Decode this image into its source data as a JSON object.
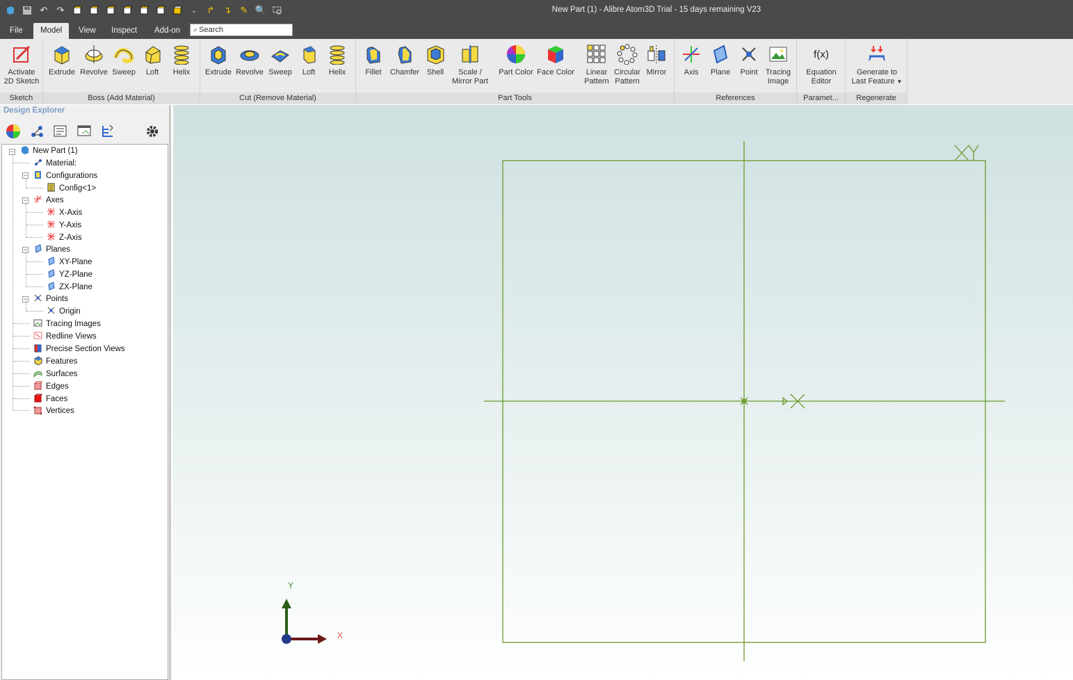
{
  "window": {
    "title": "New Part (1) - Alibre Atom3D  Trial - 15 days remaining V23"
  },
  "quick_access": [
    "app-icon",
    "save-icon",
    "undo-icon",
    "redo-icon",
    "view-front-icon",
    "view-back-icon",
    "view-top-icon",
    "view-bottom-icon",
    "view-left-icon",
    "view-right-icon",
    "view-iso-icon",
    "dropdown-icon",
    "move-icon",
    "rotate-icon",
    "measure-icon",
    "zoom-icon",
    "zoom-window-icon"
  ],
  "menu": {
    "tabs": [
      "File",
      "Model",
      "View",
      "Inspect",
      "Add-on"
    ],
    "active": "Model",
    "search_placeholder": "Search"
  },
  "ribbon": {
    "groups": [
      {
        "label": "Sketch",
        "buttons": [
          {
            "label1": "Activate",
            "label2": "2D Sketch"
          }
        ]
      },
      {
        "label": "Boss (Add Material)",
        "buttons": [
          {
            "label1": "Extrude"
          },
          {
            "label1": "Revolve"
          },
          {
            "label1": "Sweep"
          },
          {
            "label1": "Loft"
          },
          {
            "label1": "Helix"
          }
        ]
      },
      {
        "label": "Cut (Remove Material)",
        "buttons": [
          {
            "label1": "Extrude"
          },
          {
            "label1": "Revolve"
          },
          {
            "label1": "Sweep"
          },
          {
            "label1": "Loft"
          },
          {
            "label1": "Helix"
          }
        ]
      },
      {
        "label": "Part Tools",
        "buttons": [
          {
            "label1": "Fillet"
          },
          {
            "label1": "Chamfer"
          },
          {
            "label1": "Shell"
          },
          {
            "label1": "Scale /",
            "label2": "Mirror Part"
          },
          {
            "label1": "Part Color"
          },
          {
            "label1": "Face Color"
          },
          {
            "label1": "Linear",
            "label2": "Pattern"
          },
          {
            "label1": "Circular",
            "label2": "Pattern"
          },
          {
            "label1": "Mirror"
          }
        ]
      },
      {
        "label": "References",
        "buttons": [
          {
            "label1": "Axis"
          },
          {
            "label1": "Plane"
          },
          {
            "label1": "Point"
          },
          {
            "label1": "Tracing",
            "label2": "Image"
          }
        ]
      },
      {
        "label": "Paramet...",
        "buttons": [
          {
            "label1": "Equation",
            "label2": "Editor"
          }
        ]
      },
      {
        "label": "Regenerate",
        "buttons": [
          {
            "label1": "Generate to",
            "label2": "Last Feature"
          }
        ]
      }
    ]
  },
  "explorer": {
    "title": "Design Explorer",
    "tree": [
      {
        "label": "New Part (1)",
        "icon": "part-icon"
      },
      {
        "label": "Material:",
        "icon": "material-icon"
      },
      {
        "label": "Configurations",
        "icon": "configurations-icon"
      },
      {
        "label": "Config<1>",
        "icon": "config-icon"
      },
      {
        "label": "Axes",
        "icon": "axes-icon"
      },
      {
        "label": "X-Axis",
        "icon": "axis-icon"
      },
      {
        "label": "Y-Axis",
        "icon": "axis-icon"
      },
      {
        "label": "Z-Axis",
        "icon": "axis-icon"
      },
      {
        "label": "Planes",
        "icon": "planes-icon"
      },
      {
        "label": "XY-Plane",
        "icon": "plane-icon"
      },
      {
        "label": "YZ-Plane",
        "icon": "plane-icon"
      },
      {
        "label": "ZX-Plane",
        "icon": "plane-icon"
      },
      {
        "label": "Points",
        "icon": "points-icon"
      },
      {
        "label": "Origin",
        "icon": "origin-icon"
      },
      {
        "label": "Tracing Images",
        "icon": "tracing-images-icon"
      },
      {
        "label": "Redline Views",
        "icon": "redline-views-icon"
      },
      {
        "label": "Precise Section Views",
        "icon": "section-views-icon"
      },
      {
        "label": "Features",
        "icon": "features-icon"
      },
      {
        "label": "Surfaces",
        "icon": "surfaces-icon"
      },
      {
        "label": "Edges",
        "icon": "edges-icon"
      },
      {
        "label": "Faces",
        "icon": "faces-icon"
      },
      {
        "label": "Vertices",
        "icon": "vertices-icon"
      }
    ]
  },
  "viewport": {
    "plane_label": "XY",
    "triad_x": "X",
    "triad_y": "Y",
    "sketch_color": "#6a9a2a"
  }
}
